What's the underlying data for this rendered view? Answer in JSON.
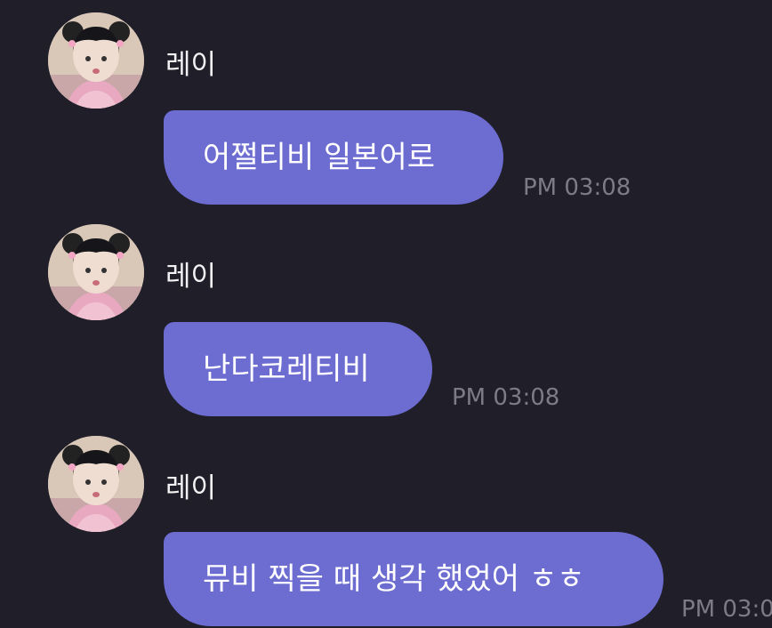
{
  "messages": [
    {
      "sender": "레이",
      "text": "어쩔티비 일본어로",
      "time": "PM 03:08"
    },
    {
      "sender": "레이",
      "text": "난다코레티비",
      "time": "PM 03:08"
    },
    {
      "sender": "레이",
      "text": "뮤비 찍을 때 생각 했었어 ㅎㅎ",
      "time": "PM 03:0"
    }
  ],
  "colors": {
    "background": "#1f1e29",
    "bubble": "#6c6cd1",
    "sender_text": "#f2f2f4",
    "time_text": "#7c7b86"
  }
}
